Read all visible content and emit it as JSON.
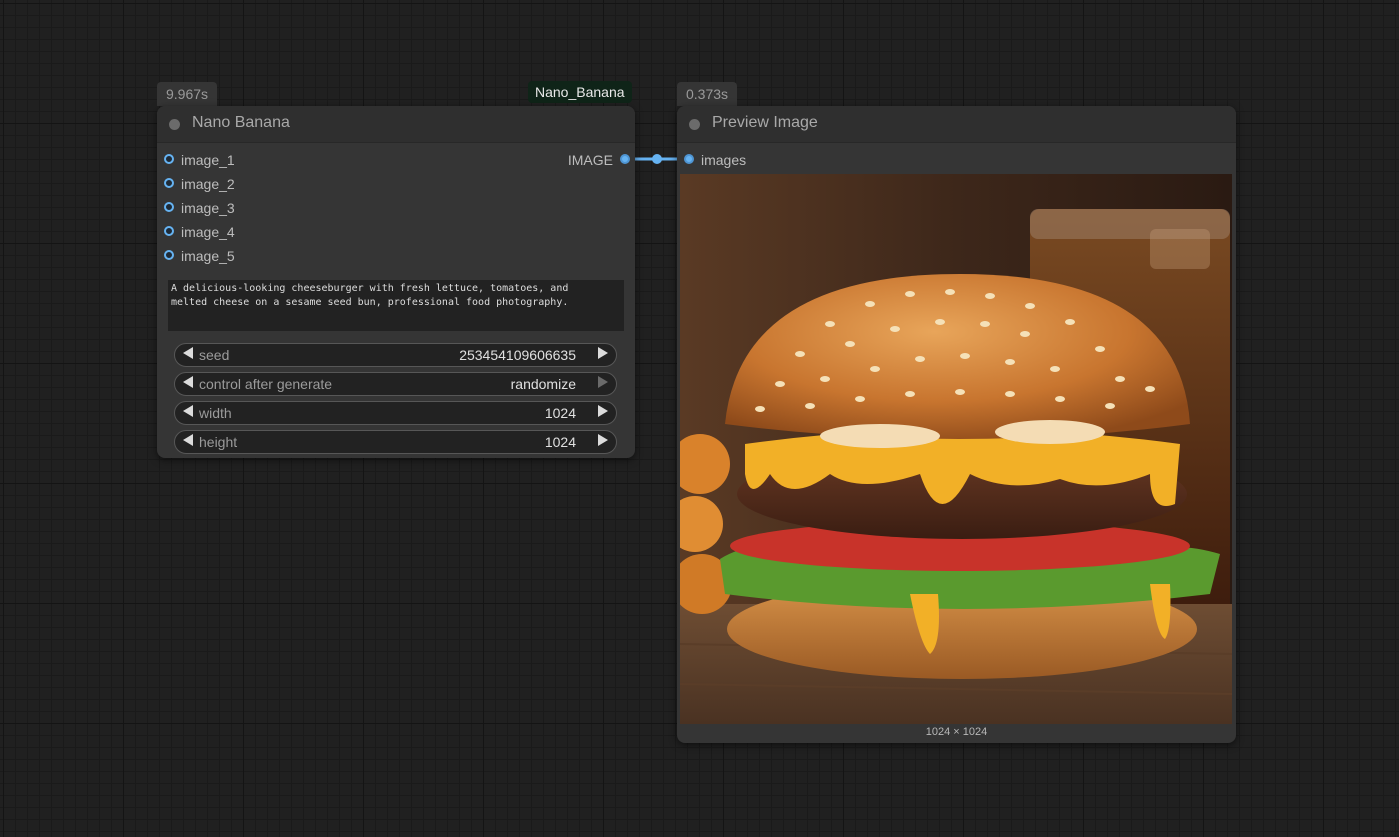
{
  "canvas": {
    "background": "#202020",
    "link_color": "#66b3f2"
  },
  "nodes": {
    "nano_banana": {
      "time": "9.967s",
      "name_badge": "Nano_Banana",
      "title": "Nano Banana",
      "inputs": [
        "image_1",
        "image_2",
        "image_3",
        "image_4",
        "image_5"
      ],
      "output": "IMAGE",
      "prompt": "A delicious-looking cheeseburger with fresh lettuce, tomatoes, and\nmelted cheese on a sesame seed bun, professional food photography.",
      "widgets": [
        {
          "label": "seed",
          "value": "253454109606635"
        },
        {
          "label": "control after generate",
          "value": "randomize"
        },
        {
          "label": "width",
          "value": "1024"
        },
        {
          "label": "height",
          "value": "1024"
        }
      ]
    },
    "preview_image": {
      "time": "0.373s",
      "title": "Preview Image",
      "input": "images",
      "image_subject": "cheeseburger-photo",
      "dimensions": "1024 × 1024"
    }
  },
  "icons": {
    "node_status": "circle-icon",
    "slot": "socket-icon",
    "decrement": "triangle-left-icon",
    "increment": "triangle-right-icon"
  }
}
